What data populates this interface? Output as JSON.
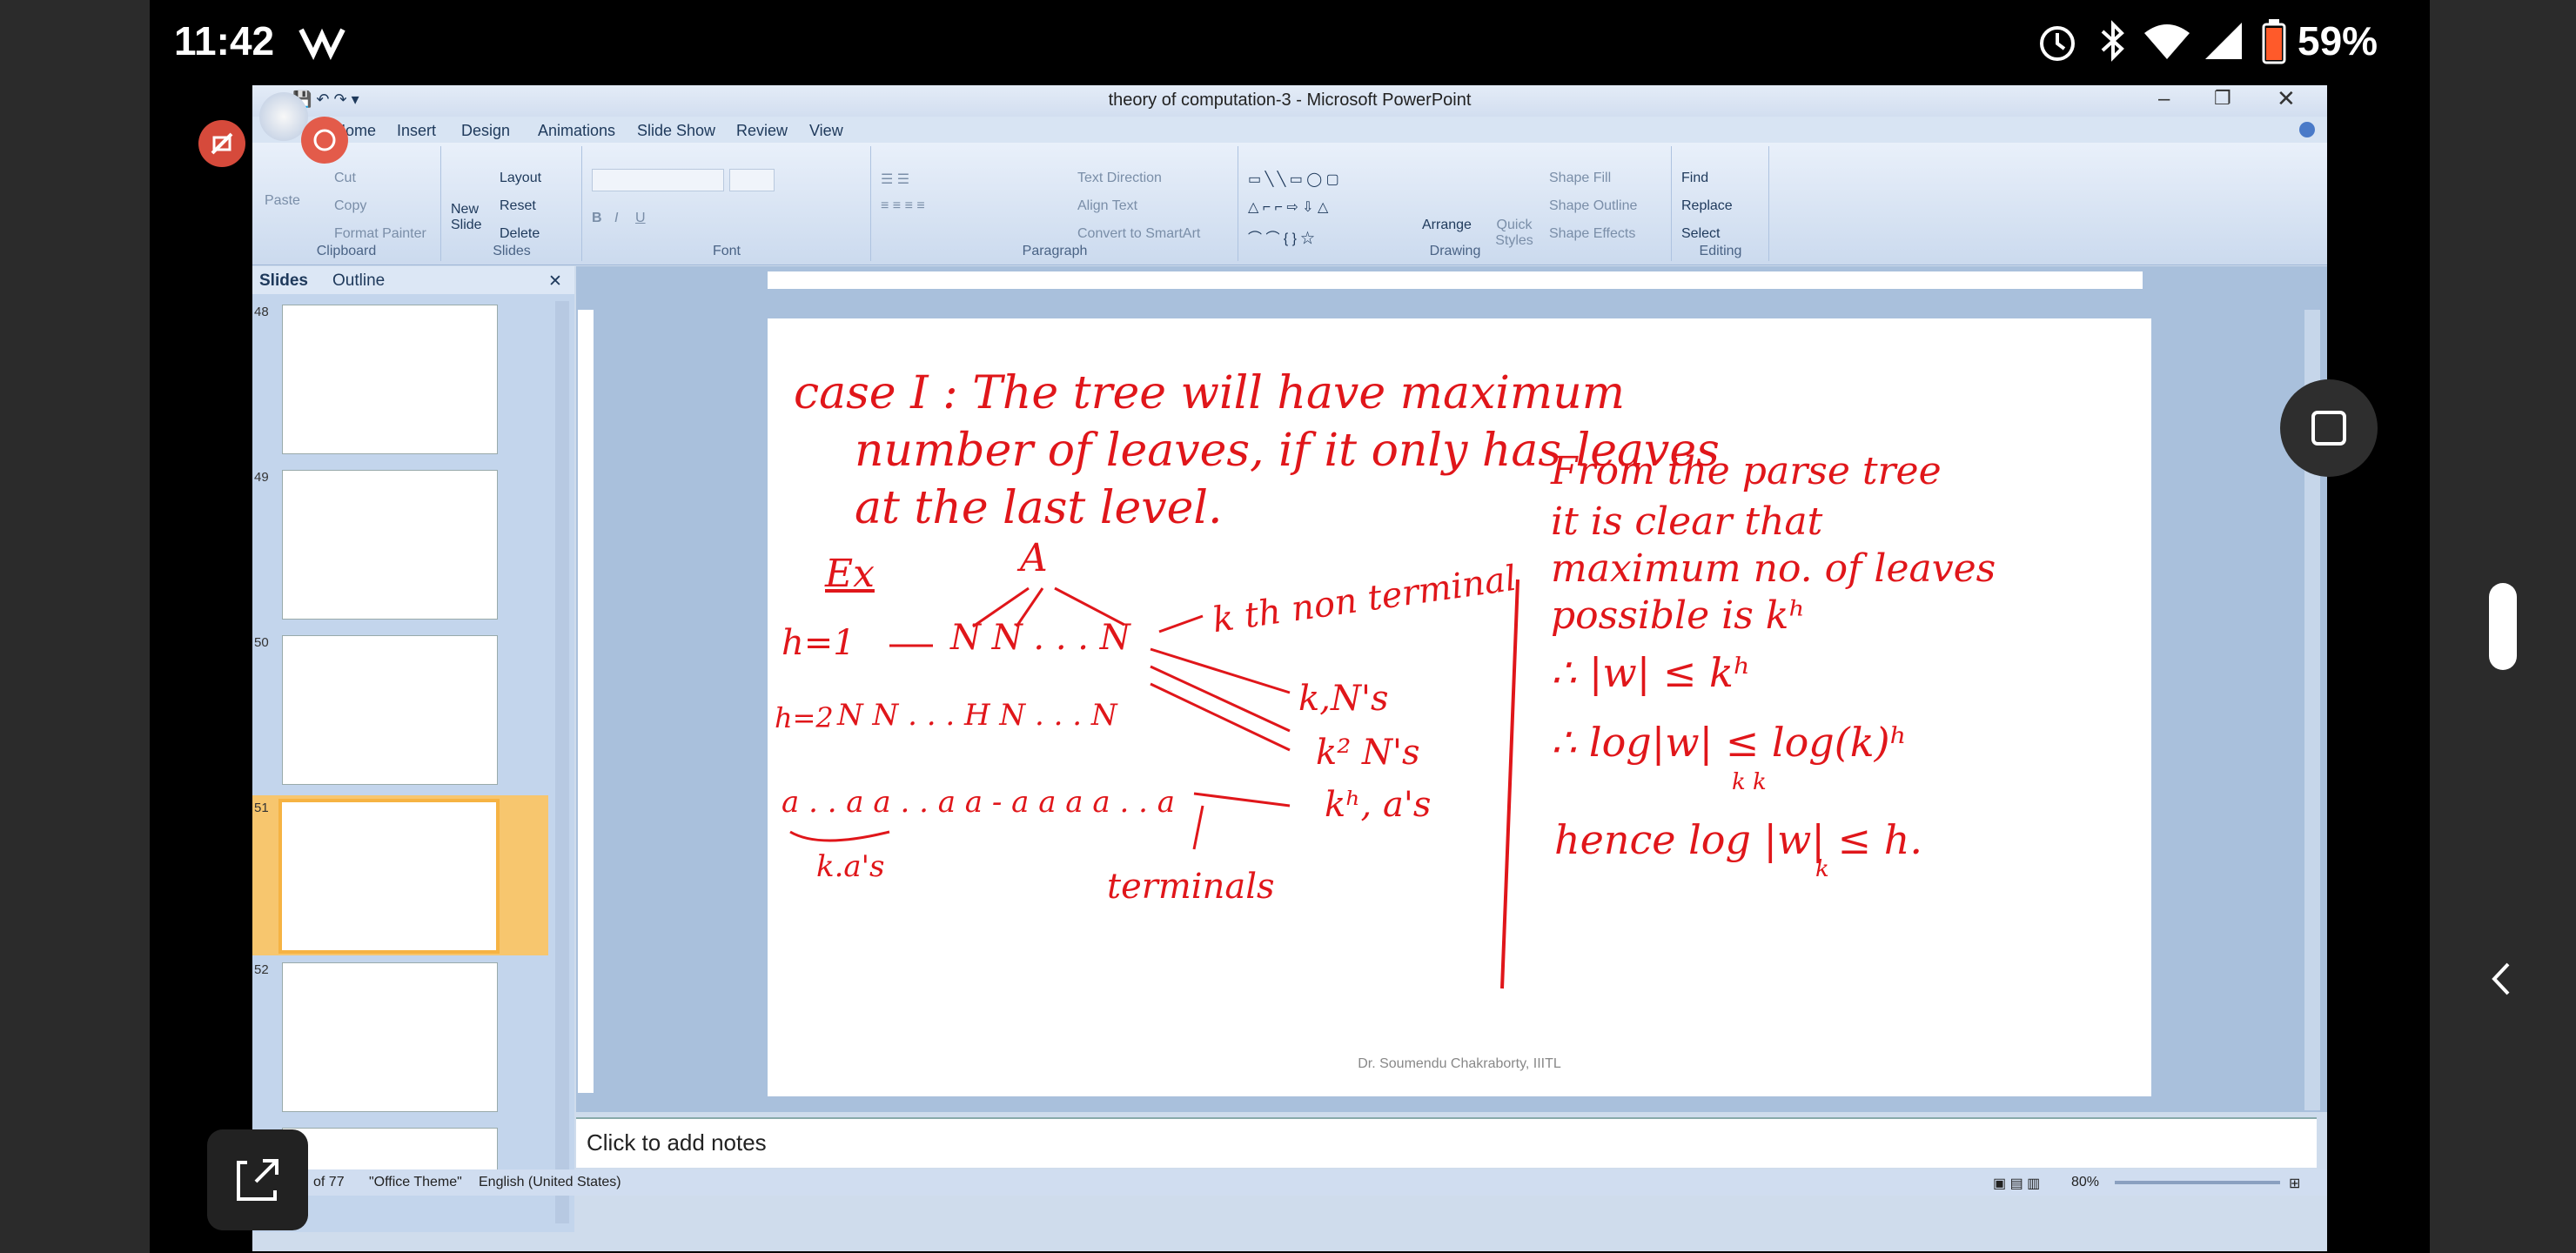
{
  "status": {
    "time": "11:42",
    "battery": "59%"
  },
  "window": {
    "title": "theory of computation-3 - Microsoft PowerPoint"
  },
  "ribbon_tabs": [
    "Home",
    "Insert",
    "Design",
    "Animations",
    "Slide Show",
    "Review",
    "View"
  ],
  "ribbon": {
    "clipboard": {
      "paste": "Paste",
      "cut": "Cut",
      "copy": "Copy",
      "format_painter": "Format Painter",
      "label": "Clipboard"
    },
    "slides": {
      "new_slide": "New Slide",
      "layout": "Layout",
      "reset": "Reset",
      "delete": "Delete",
      "label": "Slides"
    },
    "font": {
      "label": "Font"
    },
    "paragraph": {
      "text_direction": "Text Direction",
      "align_text": "Align Text",
      "convert": "Convert to SmartArt",
      "label": "Paragraph"
    },
    "drawing": {
      "arrange": "Arrange",
      "quick_styles": "Quick Styles",
      "shape_fill": "Shape Fill",
      "shape_outline": "Shape Outline",
      "shape_effects": "Shape Effects",
      "label": "Drawing"
    },
    "editing": {
      "find": "Find",
      "replace": "Replace",
      "select": "Select",
      "label": "Editing"
    }
  },
  "pane_tabs": [
    "Slides",
    "Outline"
  ],
  "thumbnails": [
    "48",
    "49",
    "50",
    "51",
    "52"
  ],
  "slide": {
    "line1": "case I : The tree will have maximum",
    "line2": "number of leaves, if it only has leaves",
    "line3": "at the last level.",
    "ex": "Ex",
    "root": "A",
    "kth": "k th non terminal",
    "h1": "h=1",
    "row1": "N N . . . N",
    "kn": "k,N's",
    "h2": "h=2",
    "row2": "N N . . . H   N . . . N",
    "k2": "k² N's",
    "leaves": "a . . a a . . a a - a   a a   a . . a",
    "kh": "kʰ, a's",
    "ka": "k.a's",
    "terminals": "terminals",
    "r1": "From the parse tree",
    "r2": "it is clear that",
    "r3": "maximum no. of leaves",
    "r4": "possible is kʰ",
    "r5": "∴  |w| ≤ kʰ",
    "r6": "∴  log|w| ≤ log(k)ʰ",
    "r6b": "k                           k",
    "r7": "hence log |w| ≤ h.",
    "r7b": "k",
    "footer": "Dr. Soumendu Chakraborty, IIITL"
  },
  "notes": {
    "placeholder": "Click to add notes"
  },
  "statusbar": {
    "slide": "of 77",
    "theme": "\"Office Theme\"",
    "language": "English (United States)",
    "zoom": "80%"
  }
}
